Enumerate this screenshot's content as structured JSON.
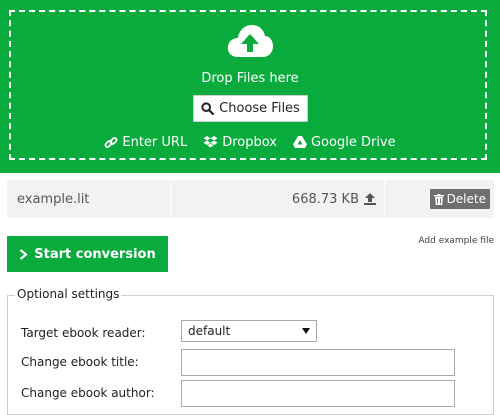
{
  "dropzone": {
    "icon": "cloud-upload-icon",
    "drop_text": "Drop Files here",
    "choose_label": "Choose Files",
    "sources": [
      {
        "icon": "link-icon",
        "label": "Enter URL"
      },
      {
        "icon": "dropbox-icon",
        "label": "Dropbox"
      },
      {
        "icon": "google-drive-icon",
        "label": "Google Drive"
      }
    ],
    "background_color": "#0aab3d"
  },
  "file": {
    "name": "example.lit",
    "size": "668.73 KB",
    "delete_label": "Delete"
  },
  "actions": {
    "start_label": "Start conversion",
    "add_example_label": "Add example file"
  },
  "settings": {
    "legend": "Optional settings",
    "target_reader_label": "Target ebook reader:",
    "target_reader_value": "default",
    "title_label": "Change ebook title:",
    "title_value": "",
    "author_label": "Change ebook author:",
    "author_value": ""
  }
}
